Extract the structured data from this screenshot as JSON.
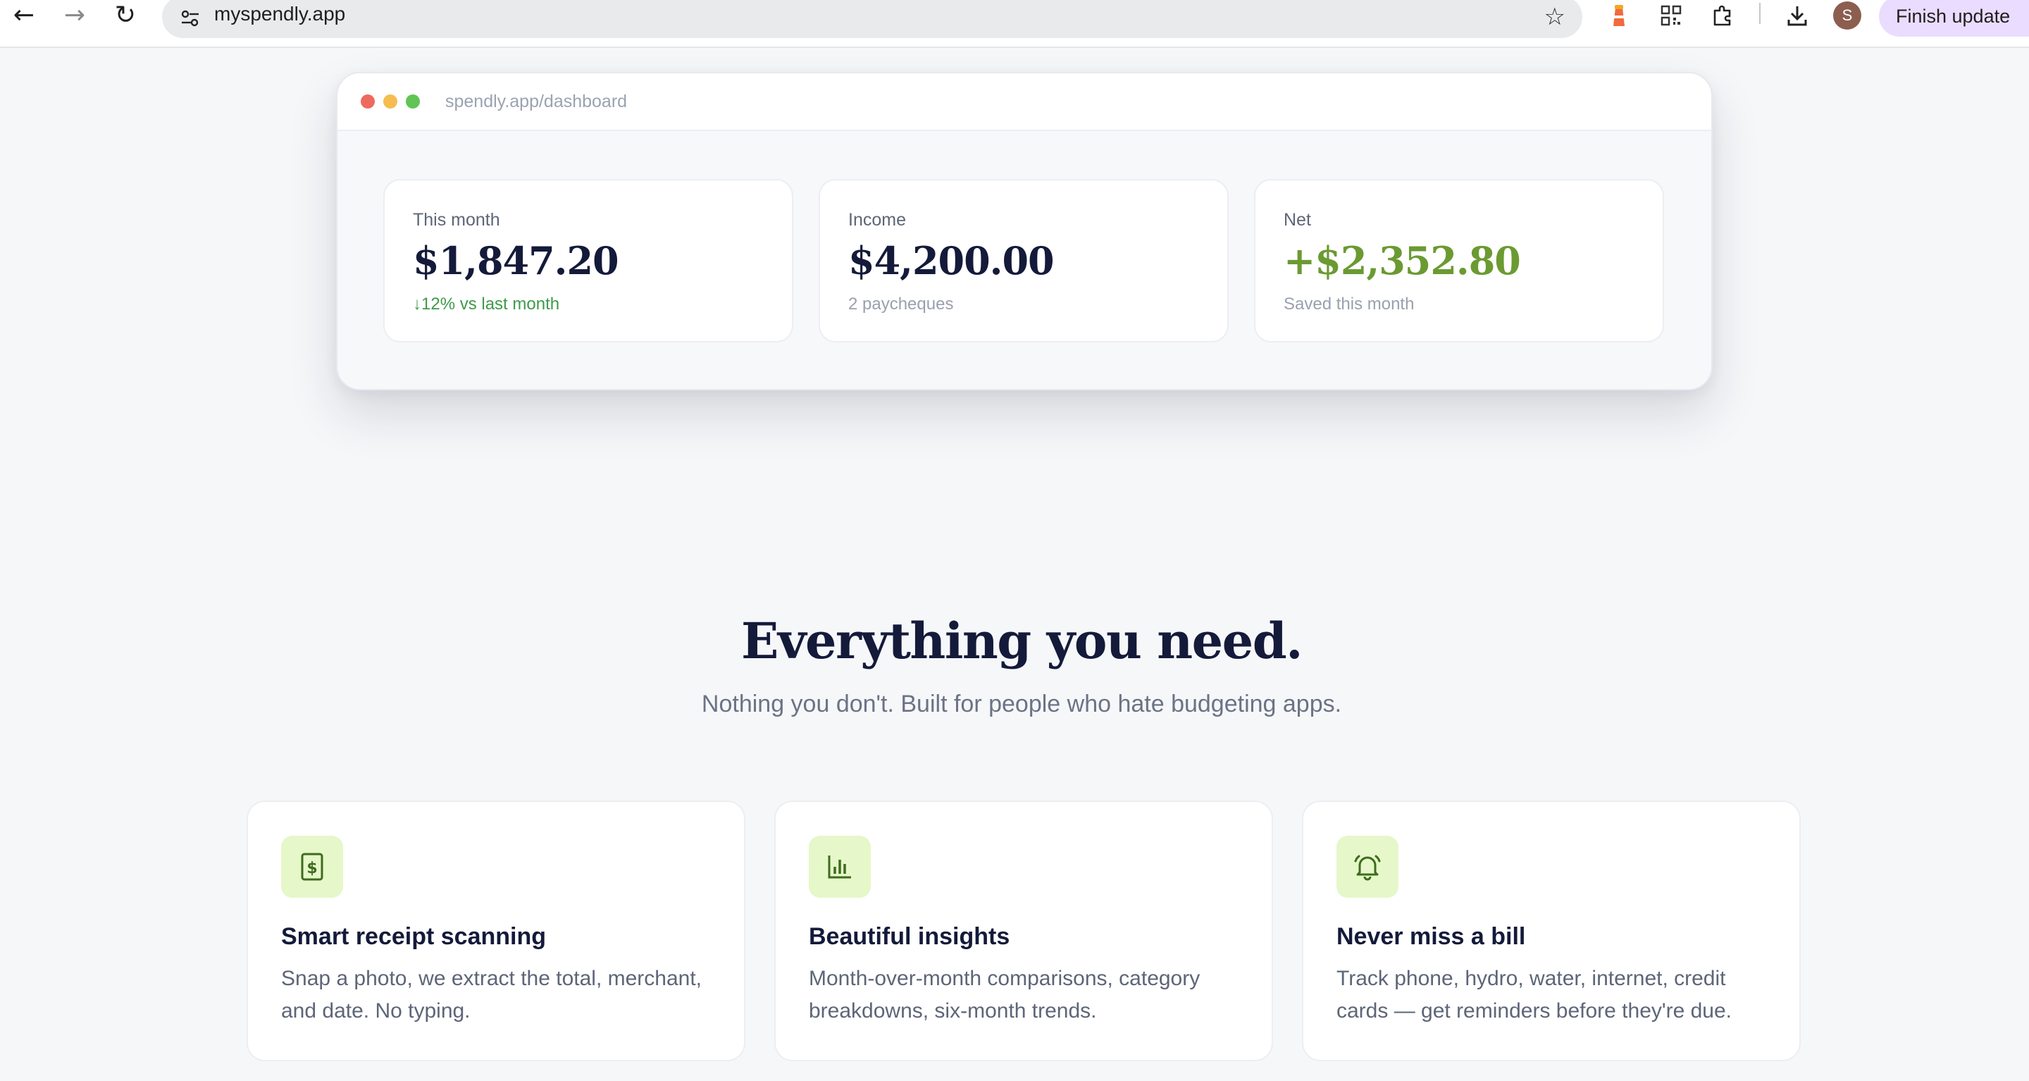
{
  "browser": {
    "url": "myspendly.app",
    "avatar_initial": "S",
    "finish_update_label": "Finish update",
    "back_icon": "←",
    "forward_icon": "→",
    "reload_icon": "↻",
    "site_info_icon": "⚙",
    "star_icon": "☆"
  },
  "dashboard_preview": {
    "url": "spendly.app/dashboard",
    "stats": [
      {
        "label": "This month",
        "value": "$1,847.20",
        "sub": "↓12% vs last month",
        "sub_color": "#3f9a4a"
      },
      {
        "label": "Income",
        "value": "$4,200.00",
        "sub": "2 paycheques"
      },
      {
        "label": "Net",
        "value": "+$2,352.80",
        "sub": "Saved this month",
        "value_color": "#6b9a32"
      }
    ]
  },
  "features": {
    "heading": "Everything you need.",
    "subheading": "Nothing you don't. Built for people who hate budgeting apps.",
    "cards": [
      {
        "icon": "receipt-dollar-icon",
        "title": "Smart receipt scanning",
        "description": "Snap a photo, we extract the total, merchant, and date. No typing."
      },
      {
        "icon": "bar-chart-icon",
        "title": "Beautiful insights",
        "description": "Month-over-month comparisons, category breakdowns, six-month trends."
      },
      {
        "icon": "bell-icon",
        "title": "Never miss a bill",
        "description": "Track phone, hydro, water, internet, credit cards — get reminders before they're due."
      }
    ]
  },
  "colors": {
    "accent_green": "#6b9a32",
    "icon_tile_bg": "#e6f7c9",
    "heading_navy": "#141a3a",
    "update_pill": "#eadcff"
  }
}
